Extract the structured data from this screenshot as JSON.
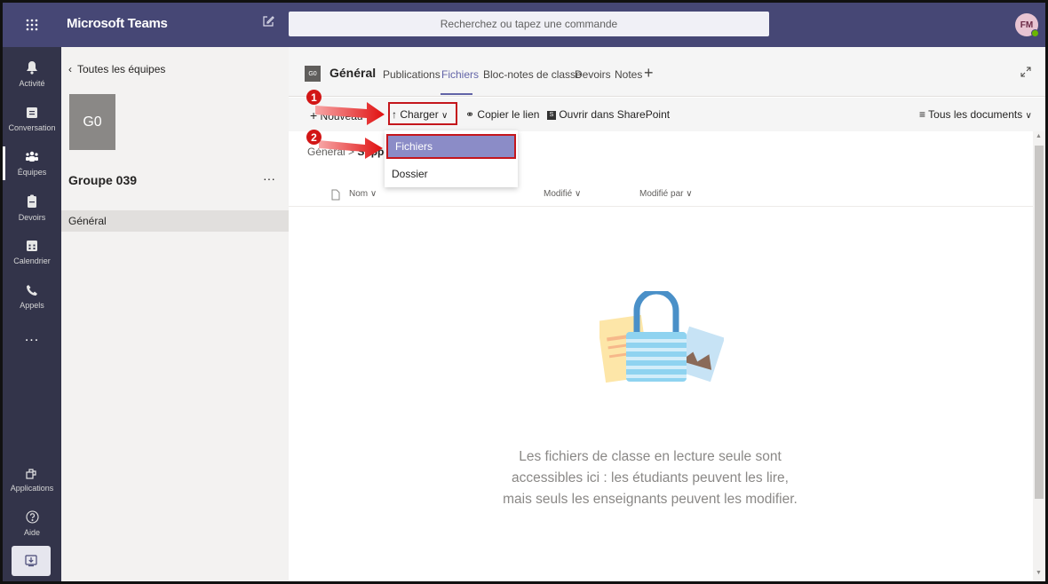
{
  "app": {
    "title": "Microsoft Teams"
  },
  "search": {
    "placeholder": "Recherchez ou tapez une commande"
  },
  "user": {
    "initials": "FM"
  },
  "rail": {
    "items": [
      {
        "label": "Activité",
        "icon": "bell-icon"
      },
      {
        "label": "Conversation",
        "icon": "chat-icon"
      },
      {
        "label": "Équipes",
        "icon": "teams-icon"
      },
      {
        "label": "Devoirs",
        "icon": "assignments-icon"
      },
      {
        "label": "Calendrier",
        "icon": "calendar-icon"
      },
      {
        "label": "Appels",
        "icon": "phone-icon"
      }
    ],
    "more": "...",
    "apps_label": "Applications",
    "help_label": "Aide"
  },
  "panel": {
    "back_label": "Toutes les équipes",
    "team_initials": "G0",
    "team_name": "Groupe 039",
    "team_more": "···",
    "channel": "Général"
  },
  "channel_header": {
    "initials": "G0",
    "name": "Général",
    "tabs": [
      "Publications",
      "Fichiers",
      "Bloc-notes de classe",
      "Devoirs",
      "Notes"
    ],
    "active_tab": "Fichiers",
    "add_tab": "+"
  },
  "toolbar": {
    "new_label": "Nouveau",
    "upload_label": "Charger",
    "copy_link_label": "Copier le lien",
    "sharepoint_label": "Ouvrir dans SharePoint",
    "view_label": "Tous les documents"
  },
  "breadcrumb": {
    "root": "Général",
    "current": "Suppo"
  },
  "columns": {
    "name": "Nom",
    "modified": "Modifié",
    "modified_by": "Modifié par"
  },
  "dropdown": {
    "items": [
      "Fichiers",
      "Dossier"
    ],
    "selected": "Fichiers"
  },
  "empty_state": {
    "message": "Les fichiers de classe en lecture seule sont accessibles ici : les étudiants peuvent les lire, mais seuls les enseignants peuvent les modifier."
  },
  "annotations": {
    "step1": "1",
    "step2": "2"
  },
  "colors": {
    "brand": "#464775",
    "rail": "#33344a",
    "accent": "#6264a7",
    "highlight": "#c4161c"
  }
}
